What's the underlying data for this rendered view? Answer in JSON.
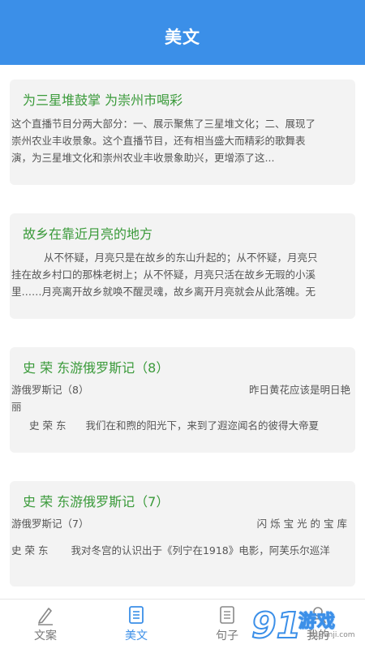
{
  "header": {
    "title": "美文"
  },
  "articles": [
    {
      "title": "为三星堆鼓掌 为崇州市喝彩",
      "lines": [
        "这个直播节目分两大部分：一、展示聚焦了三星堆文化；二、展现了",
        "崇州农业丰收景象。这个直播节目，还有相当盛大而精彩的歌舞表",
        "演，为三星堆文化和崇州农业丰收景象助兴，更增添了这..."
      ]
    },
    {
      "title": "故乡在靠近月亮的地方",
      "lines": [
        "从不怀疑，月亮只是在故乡的东山升起的；从不怀疑，月亮只",
        "挂在故乡村口的那株老树上；从不怀疑，月亮只活在故乡无瑕的小溪",
        "里……月亮离开故乡就唤不醒灵魂，故乡离开月亮就会从此落魄。无"
      ]
    },
    {
      "title": "史 荣 东游俄罗斯记（8）",
      "line1_left": "游俄罗斯记（8）",
      "line1_right": "昨日黄花应该是明日艳",
      "line2": "丽",
      "line3_author": "史 荣 东",
      "line3_text": "我们在和煦的阳光下，来到了遐迩闻名的彼得大帝夏"
    },
    {
      "title": "史 荣 东游俄罗斯记（7）",
      "line1_left": "游俄罗斯记（7）",
      "line1_right": "闪 烁 宝 光 的 宝 库",
      "line2_author": "史 荣 东",
      "line2_text": "我对冬宫的认识出于《列宁在1918》电影，阿芙乐尔巡洋"
    }
  ],
  "tabs": [
    {
      "label": "文案",
      "icon": "pen-icon",
      "active": false
    },
    {
      "label": "美文",
      "icon": "document-icon",
      "active": true
    },
    {
      "label": "句子",
      "icon": "list-icon",
      "active": false
    },
    {
      "label": "我的",
      "icon": "user-icon",
      "active": false
    }
  ],
  "watermark": {
    "text": "游戏",
    "url": "91danji.com"
  },
  "colors": {
    "primary": "#3b8fe8",
    "title_green": "#3a9a3a",
    "card_bg": "#f3f3f3"
  }
}
